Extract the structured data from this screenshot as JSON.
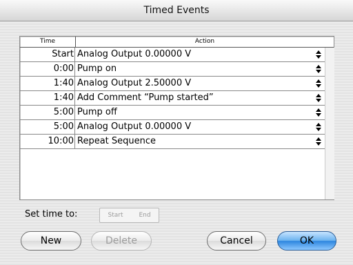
{
  "window": {
    "title": "Timed Events"
  },
  "table": {
    "columns": [
      "Time",
      "Action"
    ],
    "rows": [
      {
        "time": "Start",
        "action": "Analog Output 0.00000 V"
      },
      {
        "time": "0:00",
        "action": "Pump on"
      },
      {
        "time": "1:40",
        "action": "Analog Output 2.50000 V"
      },
      {
        "time": "1:40",
        "action": "Add Comment “Pump started”"
      },
      {
        "time": "5:00",
        "action": "Pump off"
      },
      {
        "time": "5:00",
        "action": "Analog Output 0.00000 V"
      },
      {
        "time": "10:00",
        "action": "Repeat Sequence"
      }
    ]
  },
  "set_time": {
    "label": "Set time to:",
    "start": "Start",
    "end": "End"
  },
  "buttons": {
    "new": "New",
    "delete": "Delete",
    "cancel": "Cancel",
    "ok": "OK"
  },
  "icons": {
    "row_stepper": "up-down-arrows-icon"
  }
}
